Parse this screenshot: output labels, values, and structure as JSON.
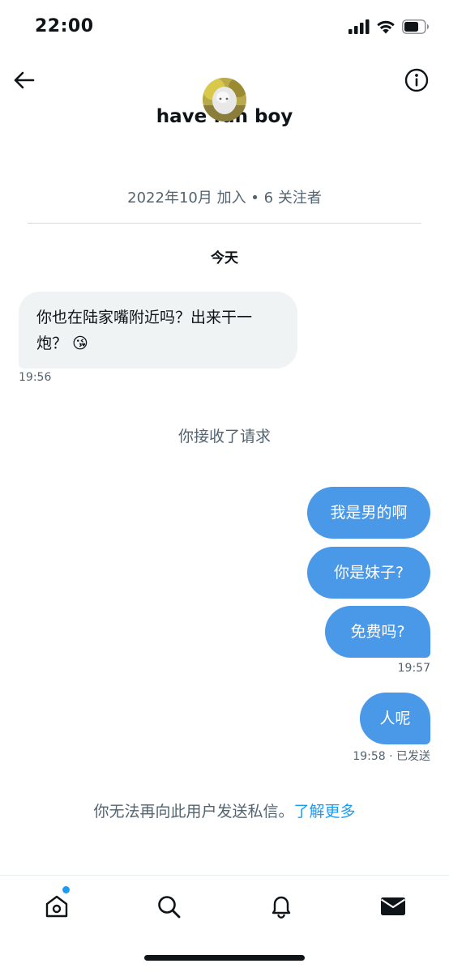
{
  "status_bar": {
    "time": "22:00",
    "icons": [
      "cellular-signal-icon",
      "wifi-icon",
      "battery-icon"
    ]
  },
  "header": {
    "back_icon": "arrow-left-icon",
    "info_icon": "info-circle-icon",
    "profile_name": "have fun boy",
    "profile_meta": "2022年10月 加入 • 6 关注者"
  },
  "conversation": {
    "day_label": "今天",
    "received": {
      "text": "你也在陆家嘴附近吗？出来干一炮？ 😘",
      "time": "19:56"
    },
    "system_message": "你接收了请求",
    "sent": [
      {
        "text": "我是男的啊"
      },
      {
        "text": "你是妹子?"
      },
      {
        "text": "免费吗?"
      },
      {
        "text": "人呢"
      }
    ],
    "sent_time_1": "19:57",
    "sent_time_2": "19:58 · 已发送"
  },
  "footer": {
    "notice": "你无法再向此用户发送私信。",
    "link": "了解更多"
  },
  "tab_bar": {
    "items": [
      {
        "icon": "home-icon",
        "has_dot": true
      },
      {
        "icon": "search-icon"
      },
      {
        "icon": "bell-icon"
      },
      {
        "icon": "mail-icon",
        "active": true
      }
    ]
  },
  "colors": {
    "accent": "#1d9bf0",
    "sent_bubble": "#4a99e9",
    "received_bubble": "#eff3f4",
    "secondary_text": "#536471"
  }
}
